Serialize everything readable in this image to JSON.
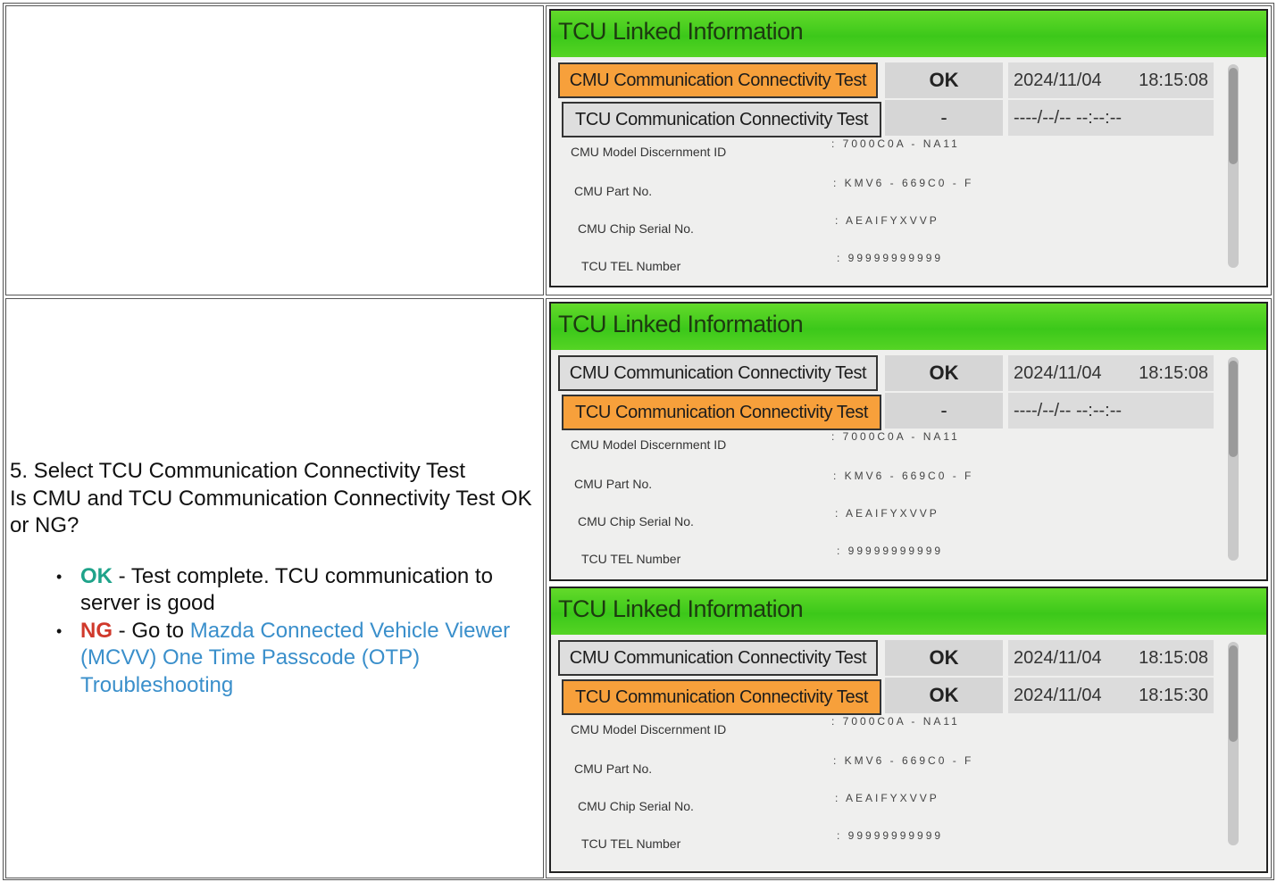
{
  "instructions": {
    "step": "5. Select TCU Communication Connectivity Test",
    "question": "Is CMU and TCU Communication Connectivity Test OK or NG?",
    "options": [
      {
        "tag": "OK",
        "text": " - Test complete. TCU communication to server is good"
      },
      {
        "tag": "NG",
        "text": " - Go to ",
        "link": "Mazda Connected Vehicle Viewer (MCVV) One Time Passcode (OTP) Troubleshooting"
      }
    ]
  },
  "screens": [
    {
      "title": "TCU Linked Information",
      "cmu_test": {
        "label": "CMU Communication Connectivity Test",
        "result": "OK",
        "date": "2024/11/04",
        "time": "18:15:08",
        "selected": true
      },
      "tcu_test": {
        "label": "TCU Communication Connectivity Test",
        "result": "-",
        "date": "----/--/-- --:--:--",
        "time": "",
        "selected": false
      },
      "fields": [
        {
          "label": "CMU Model Discernment ID",
          "value": ": 7000C0A - NA11"
        },
        {
          "label": "CMU Part No.",
          "value": ": KMV6 - 669C0 - F"
        },
        {
          "label": "CMU Chip Serial No.",
          "value": ": AEAIFYXVVP"
        },
        {
          "label": "TCU TEL Number",
          "value": ": 99999999999"
        }
      ]
    },
    {
      "title": "TCU Linked Information",
      "cmu_test": {
        "label": "CMU Communication Connectivity Test",
        "result": "OK",
        "date": "2024/11/04",
        "time": "18:15:08",
        "selected": false
      },
      "tcu_test": {
        "label": "TCU Communication Connectivity Test",
        "result": "-",
        "date": "----/--/-- --:--:--",
        "time": "",
        "selected": true
      },
      "fields": [
        {
          "label": "CMU Model Discernment ID",
          "value": ": 7000C0A - NA11"
        },
        {
          "label": "CMU Part No.",
          "value": ": KMV6 - 669C0 - F"
        },
        {
          "label": "CMU Chip Serial No.",
          "value": ": AEAIFYXVVP"
        },
        {
          "label": "TCU TEL Number",
          "value": ": 99999999999"
        }
      ]
    },
    {
      "title": "TCU Linked Information",
      "cmu_test": {
        "label": "CMU Communication Connectivity Test",
        "result": "OK",
        "date": "2024/11/04",
        "time": "18:15:08",
        "selected": false
      },
      "tcu_test": {
        "label": "TCU Communication Connectivity Test",
        "result": "OK",
        "date": "2024/11/04",
        "time": "18:15:30",
        "selected": true
      },
      "fields": [
        {
          "label": "CMU Model Discernment ID",
          "value": ": 7000C0A - NA11"
        },
        {
          "label": "CMU Part No.",
          "value": ": KMV6 - 669C0 - F"
        },
        {
          "label": "CMU Chip Serial No.",
          "value": ": AEAIFYXVVP"
        },
        {
          "label": "TCU TEL Number",
          "value": ": 99999999999"
        }
      ]
    }
  ]
}
